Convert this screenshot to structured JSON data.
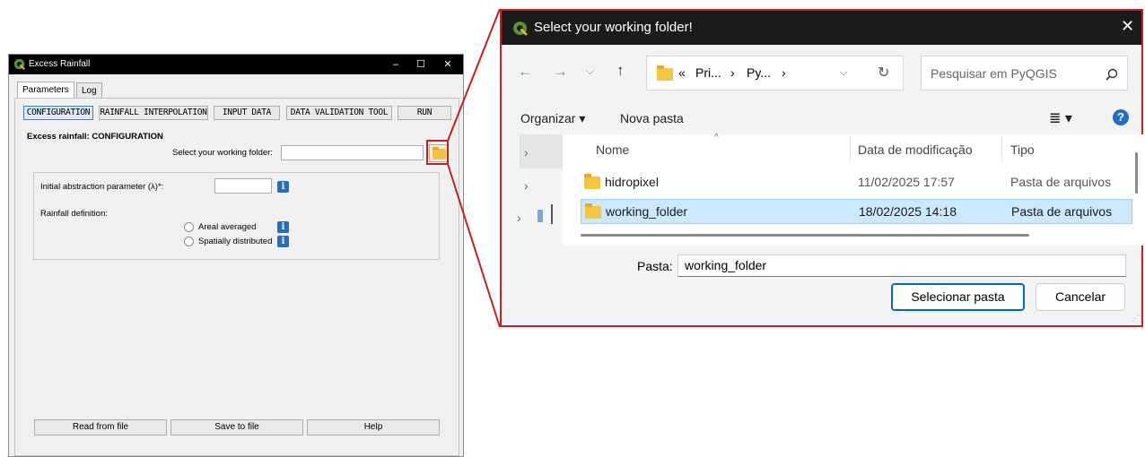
{
  "plugin_window": {
    "title": "Excess Rainfall",
    "window_buttons": [
      "–",
      "☐",
      "✕"
    ],
    "tabs": [
      "Parameters",
      "Log"
    ],
    "toolbar": [
      "CONFIGURATION",
      "RAINFALL INTERPOLATION",
      "INPUT DATA",
      "DATA VALIDATION TOOL",
      "RUN"
    ],
    "section_title": "Excess rainfall: CONFIGURATION",
    "working_folder_label": "Select your working folder:",
    "working_folder_value": "",
    "abstraction_label": "Initial abstraction parameter (λ)*:",
    "abstraction_value": "",
    "rainfall_definition_label": "Rainfall definition:",
    "radio_options": [
      "Areal averaged",
      "Spatially distributed"
    ],
    "bottom_buttons": [
      "Read from file",
      "Save to file",
      "Help"
    ]
  },
  "folder_dialog": {
    "title": "Select your working folder!",
    "breadcrumb": [
      "«",
      "Pri...",
      "›",
      "Py...",
      "›"
    ],
    "search_placeholder": "Pesquisar em PyQGIS",
    "organize_label": "Organizar ▾",
    "new_folder_label": "Nova pasta",
    "columns": [
      "Nome",
      "Data de modificação",
      "Tipo"
    ],
    "rows": [
      {
        "name": "hidropixel",
        "date": "11/02/2025 17:57",
        "type": "Pasta de arquivos",
        "selected": false
      },
      {
        "name": "working_folder",
        "date": "18/02/2025 14:18",
        "type": "Pasta de arquivos",
        "selected": true
      }
    ],
    "folder_label": "Pasta:",
    "folder_value": "working_folder",
    "select_button": "Selecionar pasta",
    "cancel_button": "Cancelar"
  },
  "colors": {
    "highlight_red": "#c52020",
    "qgis_green": "#589632",
    "selection_blue": "#cce8ff",
    "folder_yellow": "#f7c641"
  }
}
